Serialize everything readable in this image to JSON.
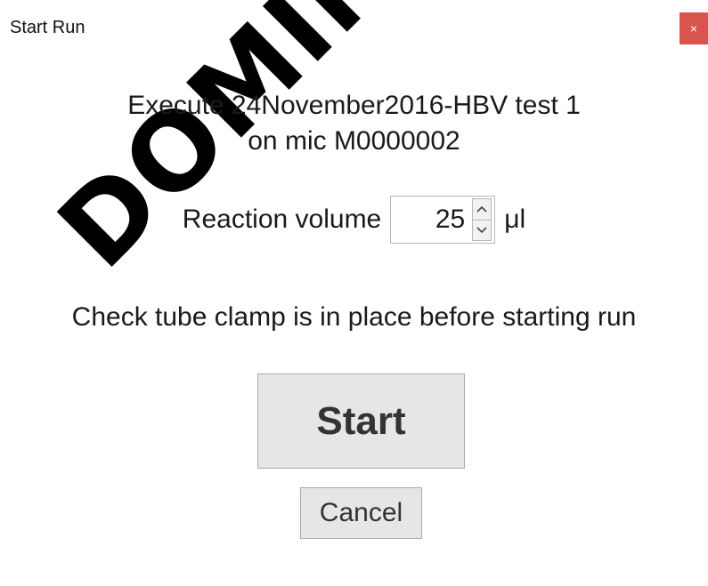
{
  "window": {
    "title": "Start Run",
    "close_glyph": "×"
  },
  "watermark": {
    "text": "DOMINIQUE"
  },
  "run_info": {
    "line1": "Execute 24November2016-HBV test 1",
    "line2": "on mic M0000002"
  },
  "reaction_volume": {
    "label": "Reaction volume",
    "value": "25",
    "unit": "μl",
    "up_glyph": "^",
    "down_glyph": "v"
  },
  "instruction": "Check tube clamp is in place before starting run",
  "buttons": {
    "start_label": "Start",
    "cancel_label": "Cancel"
  },
  "colors": {
    "close_button_bg": "#d9534f",
    "button_bg": "#e6e6e6"
  }
}
